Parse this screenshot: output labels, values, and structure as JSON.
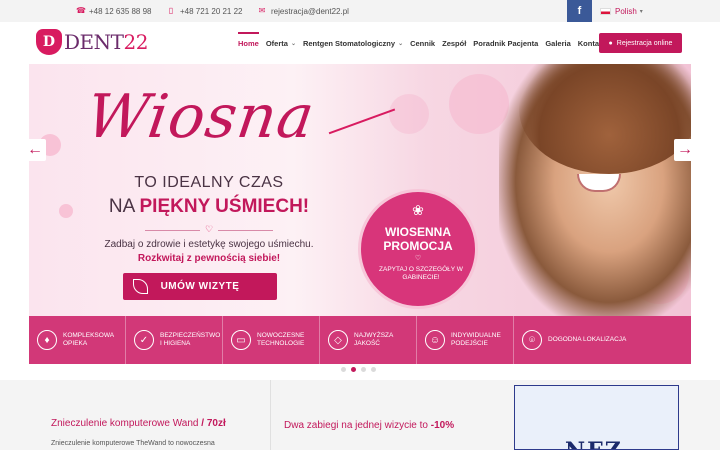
{
  "topbar": {
    "phone1": "+48 12 635 88 98",
    "phone2": "+48 721 20 21 22",
    "email": "rejestracja@dent22.pl",
    "facebook": "f",
    "language": "Polish",
    "language_caret": "▾"
  },
  "header": {
    "logo_prefix": "DENT",
    "logo_number": "22",
    "logo_mark": "D",
    "register_button": "Rejestracja online"
  },
  "nav": {
    "items": [
      {
        "label": "Home",
        "active": true
      },
      {
        "label": "Oferta",
        "caret": "⌄"
      },
      {
        "label": "Rentgen Stomatologiczny",
        "caret": "⌄"
      },
      {
        "label": "Cennik"
      },
      {
        "label": "Zespół"
      },
      {
        "label": "Poradnik Pacjenta"
      },
      {
        "label": "Galeria"
      },
      {
        "label": "Kontakt"
      }
    ]
  },
  "hero": {
    "script_title": "Wiosna",
    "line1": "TO IDEALNY CZAS",
    "line2_prefix": "NA ",
    "line2_highlight": "PIĘKNY UŚMIECH!",
    "heart": "♡",
    "line3": "Zadbaj o zdrowie i estetykę swojego uśmiechu.",
    "line4": "Rozkwitaj z pewnością siebie!",
    "cta": "UMÓW WIZYTĘ",
    "promo_flower": "❀",
    "promo_title1": "WIOSENNA",
    "promo_title2": "PROMOCJA",
    "promo_heart": "♡",
    "promo_sub": "ZAPYTAJ O SZCZEGÓŁY W GABINECIE!",
    "arrow_prev": "←",
    "arrow_next": "→",
    "slide_count": 4,
    "active_slide": 2
  },
  "features": [
    {
      "label": "Kompleksowa opieka",
      "icon": "tooth-icon",
      "glyph": "♦"
    },
    {
      "label": "Bezpieczeństwo i higiena",
      "icon": "shield-icon",
      "glyph": "✓"
    },
    {
      "label": "Nowoczesne technologie",
      "icon": "laptop-tooth-icon",
      "glyph": "▭"
    },
    {
      "label": "Najwyższa jakość",
      "icon": "diamond-icon",
      "glyph": "◇"
    },
    {
      "label": "Indywidualne podejście",
      "icon": "smile-icon",
      "glyph": "☺"
    },
    {
      "label": "Dogodna lokalizacja",
      "icon": "location-pin-icon",
      "glyph": "⌾"
    }
  ],
  "bottom": {
    "card1_title": "Znieczulenie komputerowe Wand",
    "card1_price": " / 70zł",
    "card1_desc": "Znieczulenie komputerowe TheWand to nowoczesna",
    "card2_title_prefix": "Dwa zabiegi na jednej wizycie to ",
    "card2_title_value": "-10%",
    "card3_text": "NFZ"
  },
  "colors": {
    "accent": "#c2185b",
    "feature_band": "#d23878",
    "facebook": "#3b5998"
  }
}
